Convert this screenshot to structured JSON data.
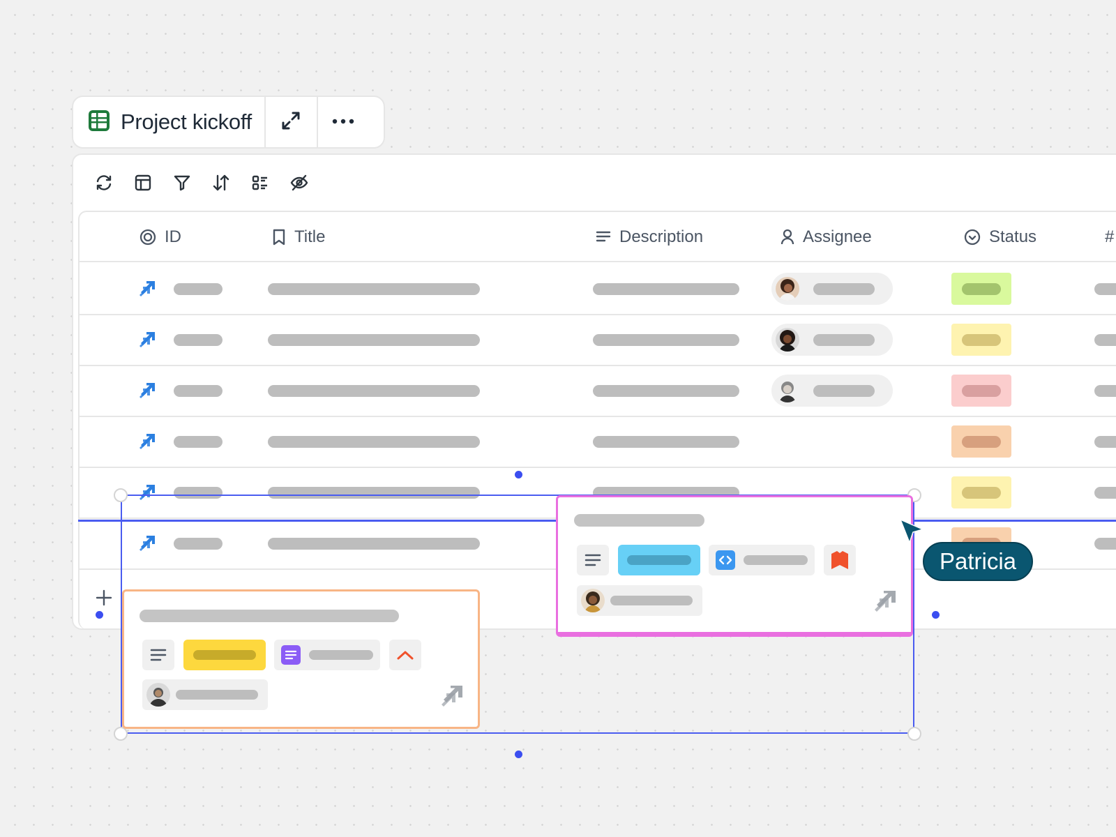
{
  "header": {
    "title": "Project kickoff",
    "icons": [
      "spreadsheet-icon",
      "expand-icon",
      "more-icon"
    ]
  },
  "toolbar": {
    "icons": [
      "sync-icon",
      "layout-icon",
      "filter-icon",
      "sort-icon",
      "group-icon",
      "hide-fields-icon"
    ]
  },
  "table": {
    "columns": [
      {
        "label": "ID",
        "icon": "target-icon"
      },
      {
        "label": "Title",
        "icon": "bookmark-icon"
      },
      {
        "label": "Description",
        "icon": "lines-icon"
      },
      {
        "label": "Assignee",
        "icon": "person-icon"
      },
      {
        "label": "Status",
        "icon": "check-circle-icon"
      },
      {
        "label": "#",
        "icon": ""
      }
    ],
    "rows": [
      {
        "assignee": true,
        "status_color": "#d9f99d",
        "status_inner": "#a3c46d"
      },
      {
        "assignee": true,
        "status_color": "#fef3b0",
        "status_inner": "#d7c57a"
      },
      {
        "assignee": true,
        "status_color": "#fbcdcd",
        "status_inner": "#d9a0a0"
      },
      {
        "assignee": false,
        "status_color": "#f9d1ad",
        "status_inner": "#d7a07e"
      },
      {
        "assignee": false,
        "status_color": "#fef3b0",
        "status_inner": "#d7c57a"
      },
      {
        "assignee": false,
        "status_color": "#f9d1ad",
        "status_inner": "#d7a07e"
      }
    ]
  },
  "cursor": {
    "user_name": "Patricia",
    "color": "#0a5670"
  },
  "colors": {
    "selection": "#4a5cf0",
    "jira_blue": "#2b7fe0",
    "card_orange_border": "#f8b585",
    "card_pink_border": "#e96fe0"
  }
}
